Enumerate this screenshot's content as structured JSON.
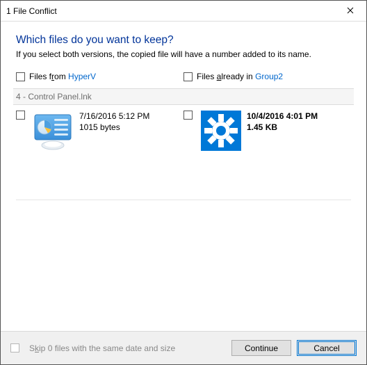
{
  "window": {
    "title": "1 File Conflict"
  },
  "heading": "Which files do you want to keep?",
  "subtext": "If you select both versions, the copied file will have a number added to its name.",
  "sourceHeader": {
    "prefix": "Files f",
    "uChar": "r",
    "suffix": "om ",
    "location": "HyperV"
  },
  "destHeader": {
    "prefix": "Files ",
    "uChar": "a",
    "suffix": "lready in ",
    "location": "Group2"
  },
  "group": {
    "index": "4",
    "name": "Control Panel.lnk"
  },
  "source": {
    "datetime": "7/16/2016 5:12 PM",
    "size": "1015 bytes"
  },
  "dest": {
    "datetime": "10/4/2016 4:01 PM",
    "size": "1.45 KB"
  },
  "footer": {
    "skip_prefix": "S",
    "skip_uChar": "k",
    "skip_suffix": "ip 0 files with the same date and size",
    "continue": "Continue",
    "cancel": "Cancel"
  }
}
